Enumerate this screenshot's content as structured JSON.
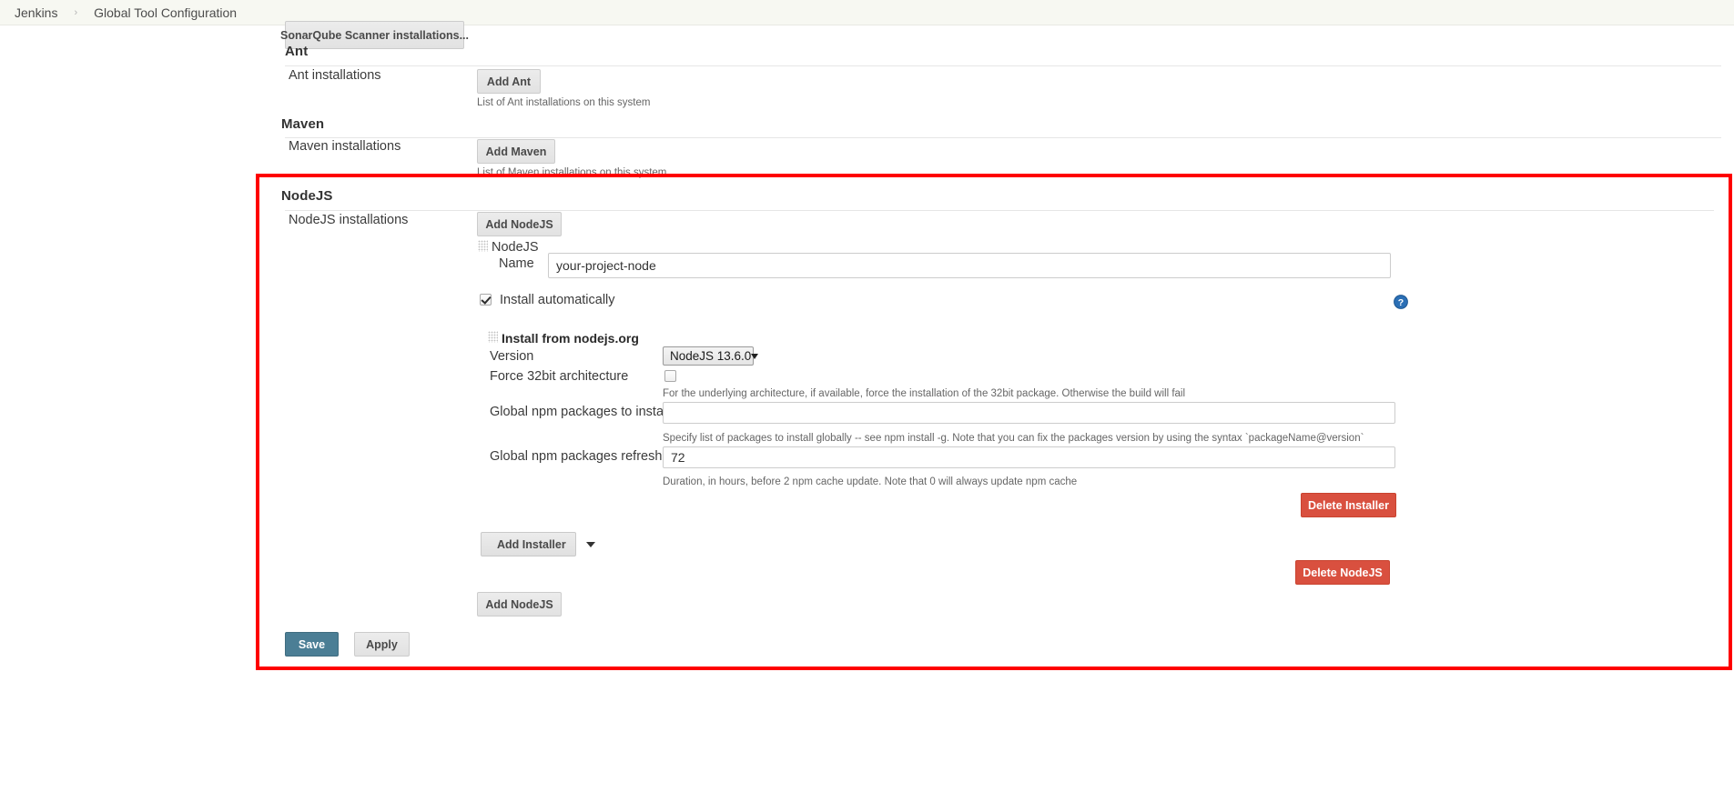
{
  "breadcrumb": {
    "root": "Jenkins",
    "separator": "›",
    "current": "Global Tool Configuration"
  },
  "sonarqube": {
    "installations_button": "SonarQube Scanner installations..."
  },
  "ant": {
    "section_title": "Ant",
    "row_label": "Ant installations",
    "add_button": "Add Ant",
    "help_text": "List of Ant installations on this system"
  },
  "maven": {
    "section_title": "Maven",
    "row_label": "Maven installations",
    "add_button": "Add Maven",
    "help_text": "List of Maven installations on this system"
  },
  "nodejs": {
    "section_title": "NodeJS",
    "row_label": "NodeJS installations",
    "add_button_top": "Add NodeJS",
    "add_button_bottom": "Add NodeJS",
    "entry_title": "NodeJS",
    "name_label": "Name",
    "name_value": "your-project-node",
    "install_automatically_label": "Install automatically",
    "install_automatically_checked": true,
    "delete_button": "Delete NodeJS",
    "add_installer_button": "Add Installer",
    "installer": {
      "heading": "Install from nodejs.org",
      "version_label": "Version",
      "version_value": "NodeJS 13.6.0",
      "force32_label": "Force 32bit architecture",
      "force32_checked": false,
      "force32_help": "For the underlying architecture, if available, force the installation of the 32bit package. Otherwise the build will fail",
      "global_packages_label": "Global npm packages to install",
      "global_packages_value": "",
      "global_packages_help": "Specify list of packages to install globally -- see npm install -g. Note that you can fix the packages version by using the syntax `packageName@version`",
      "refresh_hours_label": "Global npm packages refresh hours",
      "refresh_hours_value": "72",
      "refresh_hours_help": "Duration, in hours, before 2 npm cache update. Note that 0 will always update npm cache",
      "delete_installer_button": "Delete Installer"
    }
  },
  "footer": {
    "save_button": "Save",
    "apply_button": "Apply"
  },
  "icons": {
    "help": "help-circle-icon",
    "drag_grip": "drag-grip-icon",
    "chevron_down": "chevron-down-icon"
  },
  "colors": {
    "highlight": "#fe0000",
    "danger": "#d9503f",
    "primary": "#4b7e95",
    "breadcrumb_bg": "#f7f8f2"
  }
}
